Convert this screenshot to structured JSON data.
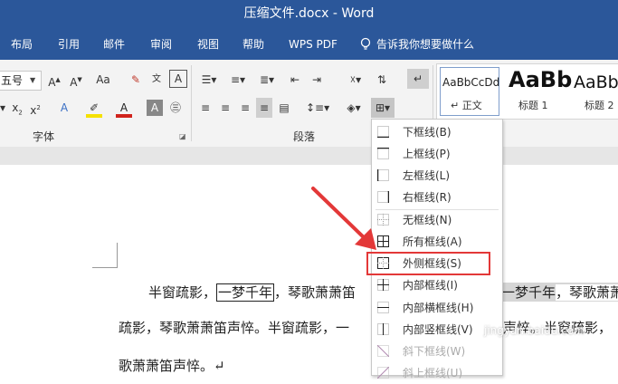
{
  "title": "压缩文件.docx  -  Word",
  "tabs": [
    "布局",
    "引用",
    "邮件",
    "审阅",
    "视图",
    "帮助",
    "WPS PDF"
  ],
  "tell_me": "告诉我你想要做什么",
  "ribbon": {
    "font_size": "五号",
    "aa_label": "Aa",
    "group_font": "字体",
    "group_paragraph": "段落",
    "styles": [
      {
        "preview": "AaBbCcDd",
        "name": "↵ 正文"
      },
      {
        "preview": "AaBb",
        "name": "标题 1"
      },
      {
        "preview": "AaBb",
        "name": "标题 2"
      }
    ]
  },
  "menu_items": [
    {
      "label": "下框线(B)",
      "disabled": false
    },
    {
      "label": "上框线(P)",
      "disabled": false
    },
    {
      "label": "左框线(L)",
      "disabled": false
    },
    {
      "label": "右框线(R)",
      "disabled": false
    },
    {
      "label": "无框线(N)",
      "disabled": false
    },
    {
      "label": "所有框线(A)",
      "disabled": false
    },
    {
      "label": "外侧框线(S)",
      "disabled": false
    },
    {
      "label": "内部框线(I)",
      "disabled": false
    },
    {
      "label": "内部横框线(H)",
      "disabled": false
    },
    {
      "label": "内部竖框线(V)",
      "disabled": false
    },
    {
      "label": "斜下框线(W)",
      "disabled": true
    },
    {
      "label": "斜上框线(U)",
      "disabled": true
    }
  ],
  "doc": {
    "l1a": "半窗疏影，",
    "l1b": "一梦千年",
    "l1c": "，琴歌萧萧笛",
    "l1d": "一梦千年",
    "l1e": "，琴歌萧萧",
    "l2a": "疏影，琴歌萧萧笛声悴。半窗疏影，一",
    "l2b": "声悴。半窗疏影，",
    "l3": "歌萧萧笛声悴。↵"
  },
  "watermark": "jingyan.baidu.com",
  "colors": {
    "brand": "#2b579a",
    "highlight_box": "#e33838",
    "arrow": "#e33838"
  }
}
